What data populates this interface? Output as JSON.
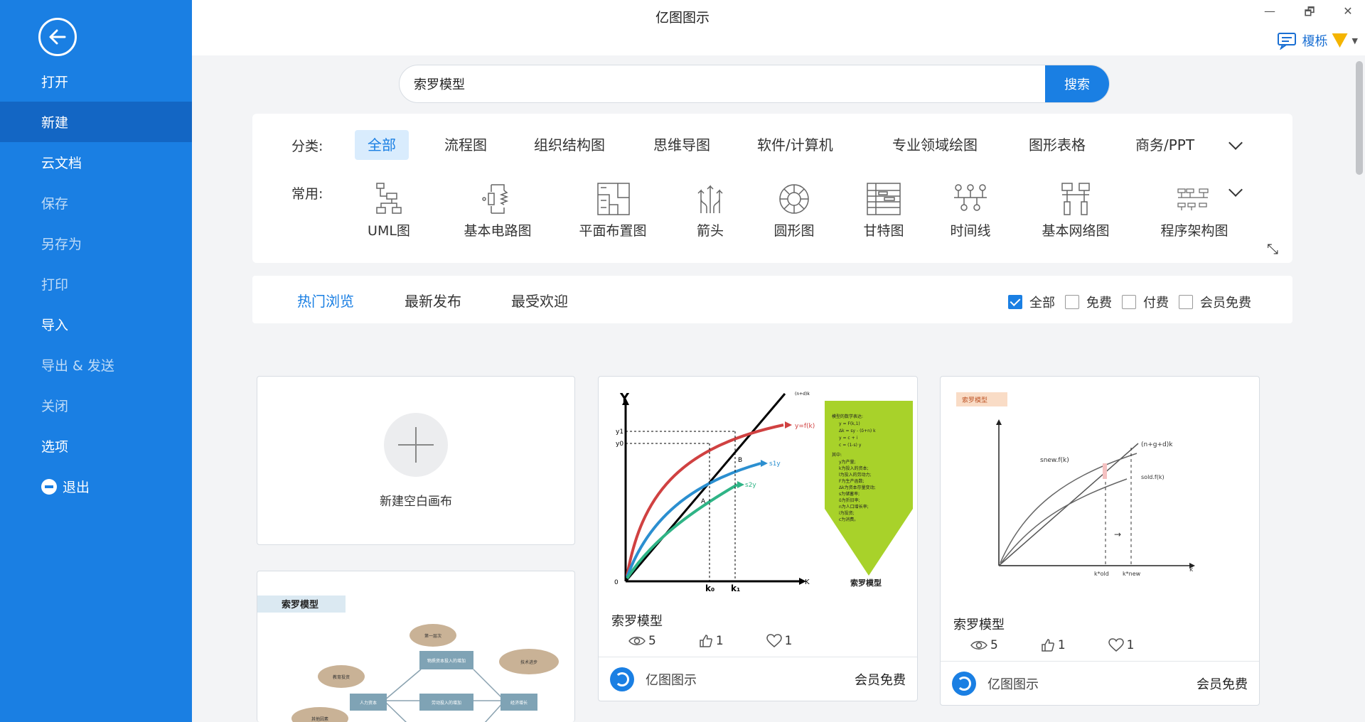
{
  "window": {
    "title": "亿图图示",
    "controls": [
      "—",
      "🗗",
      "✕"
    ]
  },
  "user": {
    "name": "榎栎"
  },
  "sidebar": {
    "items": [
      {
        "label": "打开"
      },
      {
        "label": "新建"
      },
      {
        "label": "云文档"
      },
      {
        "label": "保存"
      },
      {
        "label": "另存为"
      },
      {
        "label": "打印"
      },
      {
        "label": "导入"
      },
      {
        "label": "导出 & 发送"
      },
      {
        "label": "关闭"
      },
      {
        "label": "选项"
      },
      {
        "label": "退出"
      }
    ],
    "active": "新建"
  },
  "search": {
    "value": "索罗模型",
    "button": "搜索"
  },
  "categories": {
    "label": "分类:",
    "items": [
      "全部",
      "流程图",
      "组织结构图",
      "思维导图",
      "软件/计算机",
      "专业领域绘图",
      "图形表格",
      "商务/PPT"
    ],
    "active": "全部"
  },
  "common": {
    "label": "常用:",
    "items": [
      "UML图",
      "基本电路图",
      "平面布置图",
      "箭头",
      "圆形图",
      "甘特图",
      "时间线",
      "基本网络图",
      "程序架构图"
    ]
  },
  "tabs": {
    "items": [
      "热门浏览",
      "最新发布",
      "最受欢迎"
    ],
    "active": "热门浏览"
  },
  "filters": [
    {
      "label": "全部",
      "checked": true
    },
    {
      "label": "免费",
      "checked": false
    },
    {
      "label": "付费",
      "checked": false
    },
    {
      "label": "会员免费",
      "checked": false
    }
  ],
  "new_canvas": {
    "label": "新建空白画布"
  },
  "templates": [
    {
      "title": "索罗模型",
      "views": "5",
      "likes": "1",
      "favorites": "1",
      "author": "亿图图示",
      "price": "会员免费",
      "thumb": {
        "y_axis": "Y",
        "x_axis": "K",
        "origin": "0",
        "label_y1": "y1",
        "label_y0": "y0",
        "curve_top": "y=f(k)",
        "curve_mid": "s1y",
        "curve_low": "s2y",
        "line": "(n+d)k",
        "point_a": "A",
        "point_b": "B",
        "k0": "k₀",
        "k1": "k₁",
        "note_title": "模型的数学表达:",
        "note_lines": [
          "y = F(k,1)",
          "Δk = sy - (δ+n) k",
          "y = c + i",
          "c = (1-s) y",
          "其中:",
          "y为产量;",
          "k为投入的资本;",
          "l为投入的劳动力;",
          "F为生产函数;",
          "Δk为资本存量变动;",
          "s为储蓄率;",
          "δ为折旧率;",
          "n为人口增长率;",
          "i为投资;",
          "c为消费。"
        ],
        "tag": "索罗模型"
      }
    },
    {
      "title": "索罗模型",
      "views": "5",
      "likes": "1",
      "favorites": "1",
      "author": "亿图图示",
      "price": "会员免费",
      "thumb": {
        "tag": "索罗模型",
        "line": "(n+g+d)k",
        "curve_a": "snew.f(k)",
        "curve_b": "sold.f(k)",
        "k_old": "k*old",
        "k_new": "k*new",
        "x_axis": "k",
        "arrow": "→"
      }
    },
    {
      "thumb": {
        "tag": "索罗模型",
        "nodes": [
          "第一层次",
          "物质资本投入的增加",
          "教育投资",
          "人力资本",
          "技术进步",
          "劳动投入的增加",
          "经济增长",
          "其他因素"
        ]
      }
    }
  ]
}
